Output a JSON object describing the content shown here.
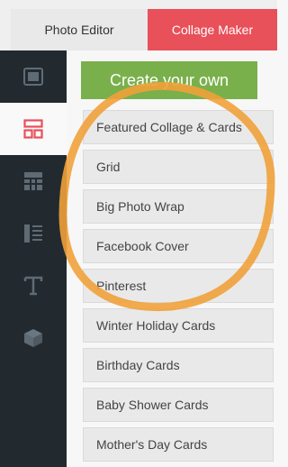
{
  "tabs": {
    "photo_editor": "Photo Editor",
    "collage_maker": "Collage Maker"
  },
  "sidebar": {
    "items": [
      {
        "icon": "image-icon",
        "active": false
      },
      {
        "icon": "layout-icon",
        "active": true
      },
      {
        "icon": "grid-icon",
        "active": false
      },
      {
        "icon": "text-layout-icon",
        "active": false
      },
      {
        "icon": "text-icon",
        "active": false
      },
      {
        "icon": "box-icon",
        "active": false
      }
    ]
  },
  "main": {
    "create_label": "Create your own",
    "items": [
      "Featured Collage & Cards",
      "Grid",
      "Big Photo Wrap",
      "Facebook Cover",
      "Pinterest",
      "Winter Holiday Cards",
      "Birthday Cards",
      "Baby Shower Cards",
      "Mother's Day Cards"
    ]
  },
  "colors": {
    "active_tab": "#e8505a",
    "create_button": "#79b04b",
    "sidebar_bg": "#222a30",
    "annotation": "#f0a13a"
  }
}
